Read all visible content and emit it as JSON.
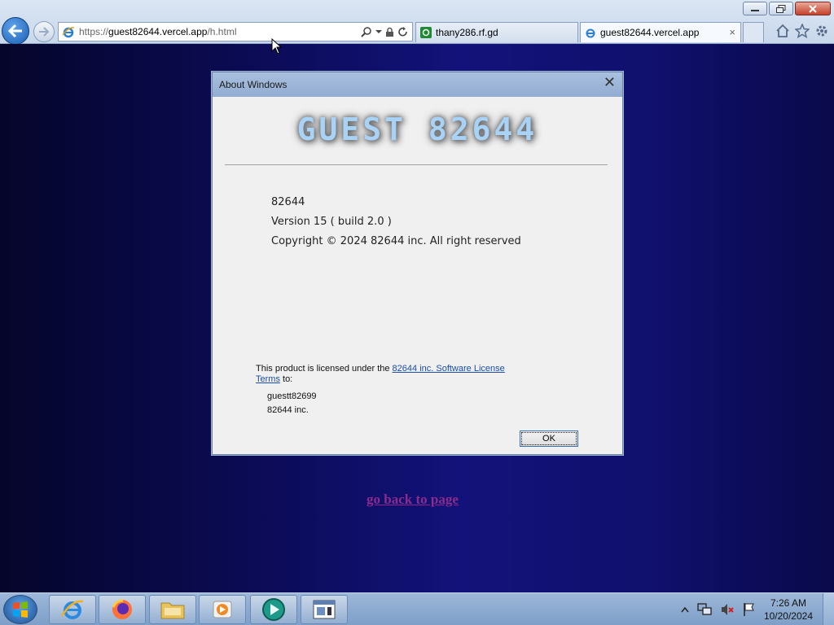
{
  "browser": {
    "url_prefix": "https://",
    "url_host": "guest82644.vercel.app",
    "url_path": "/h.html",
    "tabs": [
      {
        "label": "thany286.rf.gd"
      },
      {
        "label": "guest82644.vercel.app"
      }
    ],
    "tab_close": "×"
  },
  "dialog": {
    "title": "About Windows",
    "close_glyph": "✕",
    "logo": "GUEST 82644",
    "info": {
      "name": "82644",
      "version": "Version 15 ( build 2.0 )",
      "copyright": "Copyright © 2024 82644 inc. All right reserved"
    },
    "license": {
      "prefix": "This product is licensed under the ",
      "link": "82644 inc. Software License Terms",
      "suffix": " to:"
    },
    "licensee": {
      "user": "guestt82699",
      "org": "82644 inc."
    },
    "ok_label": "OK"
  },
  "page": {
    "back_link": "go back to page"
  },
  "taskbar": {
    "time": "7:26 AM",
    "date": "10/20/2024"
  },
  "colors": {
    "page_bg": "#0b0b55",
    "link": "#8d2b8d",
    "dialog_title": "#92acd2"
  }
}
